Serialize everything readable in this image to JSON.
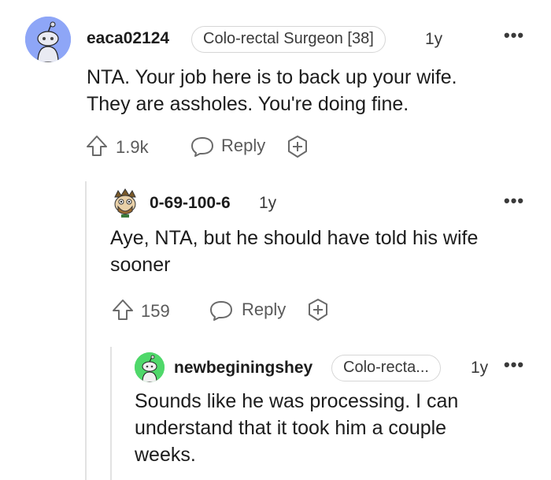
{
  "comments": [
    {
      "username": "eaca02124",
      "flair": "Colo-rectal Surgeon [38]",
      "time": "1y",
      "more_icon": "more-options-icon",
      "body_lines": [
        "NTA. Your job here is to back up your wife.",
        "They are assholes. You're doing fine."
      ],
      "votes": "1.9k",
      "reply_label": "Reply",
      "avatar_color": "#7f9bf5"
    },
    {
      "username": "0-69-100-6",
      "time": "1y",
      "more_icon": "more-options-icon",
      "body_lines": [
        "Aye, NTA, but he should have told his wife",
        "sooner"
      ],
      "votes": "159",
      "reply_label": "Reply",
      "avatar_color": "#b07a3c"
    },
    {
      "username": "newbeginingshey",
      "flair": "Colo-recta...",
      "time": "1y",
      "more_icon": "more-options-icon",
      "body_lines": [
        "Sounds like he was processing. I can",
        "understand that it took him a couple",
        "weeks."
      ],
      "avatar_color": "#46d160"
    }
  ],
  "icons": {
    "upvote": "upvote-arrow-icon",
    "reply": "speech-bubble-icon",
    "award": "add-award-icon"
  }
}
